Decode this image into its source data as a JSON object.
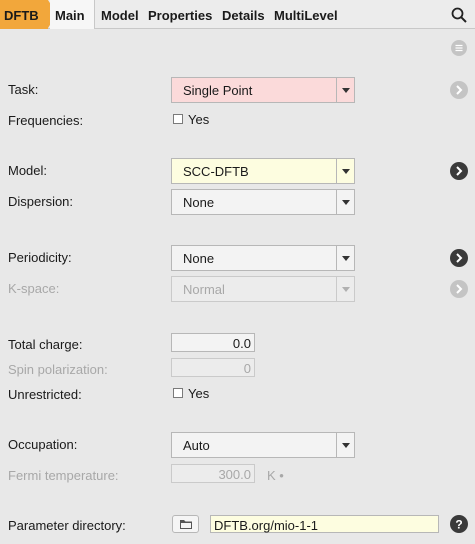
{
  "topbar": {
    "engine": "DFTB",
    "tabs": [
      "Main",
      "Model",
      "Properties",
      "Details",
      "MultiLevel"
    ]
  },
  "fields": {
    "task": {
      "label": "Task:",
      "value": "Single Point"
    },
    "frequencies": {
      "label": "Frequencies:",
      "checkbox_label": "Yes",
      "checked": false
    },
    "model": {
      "label": "Model:",
      "value": "SCC-DFTB"
    },
    "dispersion": {
      "label": "Dispersion:",
      "value": "None"
    },
    "periodicity": {
      "label": "Periodicity:",
      "value": "None"
    },
    "kspace": {
      "label": "K-space:",
      "value": "Normal"
    },
    "total_charge": {
      "label": "Total charge:",
      "value": "0.0"
    },
    "spin_polarization": {
      "label": "Spin polarization:",
      "value": "0"
    },
    "unrestricted": {
      "label": "Unrestricted:",
      "checkbox_label": "Yes",
      "checked": false
    },
    "occupation": {
      "label": "Occupation:",
      "value": "Auto"
    },
    "fermi_temperature": {
      "label": "Fermi temperature:",
      "value": "300.0",
      "unit": "K •"
    },
    "parameter_directory": {
      "label": "Parameter directory:",
      "value": "DFTB.org/mio-1-1"
    }
  },
  "colors": {
    "engine_tab": "#f2a73b",
    "task_bg": "#fbdada",
    "model_bg": "#fdfde0",
    "dark_button": "#3a3a3a",
    "disabled_button": "#c4c4c4"
  },
  "icons": [
    "search-icon",
    "menu-icon",
    "arrow-right-icon",
    "folder-icon",
    "help-icon"
  ]
}
